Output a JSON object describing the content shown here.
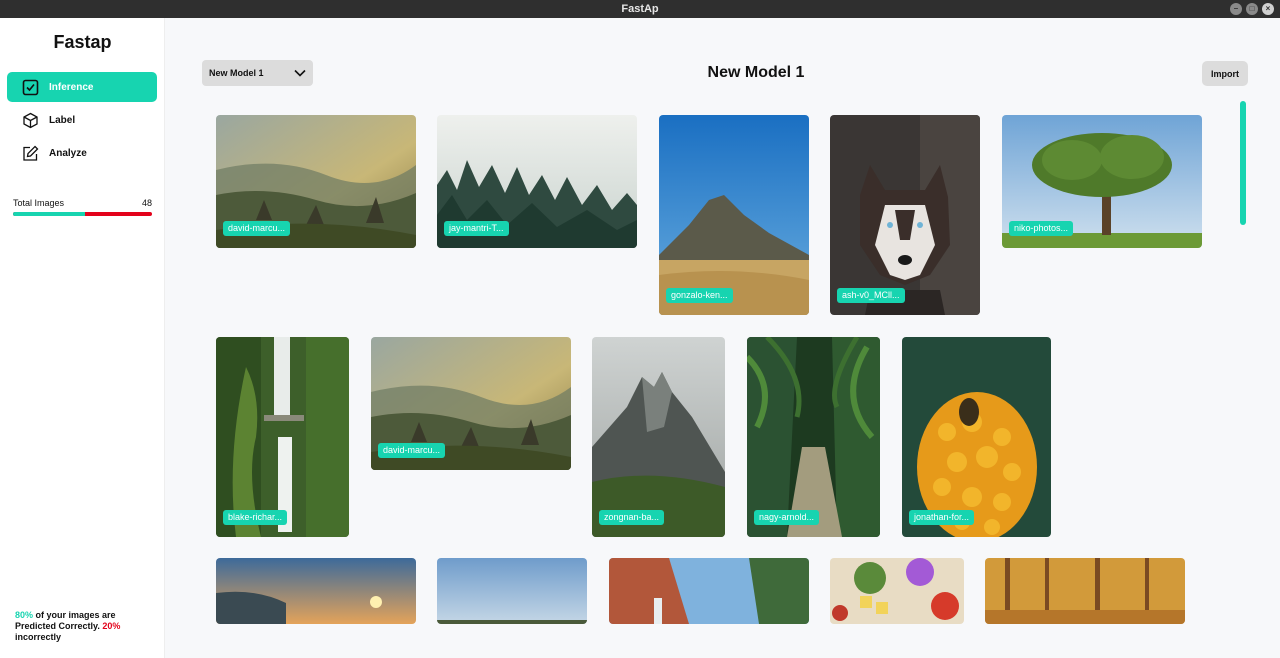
{
  "window": {
    "title": "FastAp"
  },
  "sidebar": {
    "brand": "Fastap",
    "nav": [
      {
        "label": "Inference",
        "icon": "check-square-icon",
        "active": true
      },
      {
        "label": "Label",
        "icon": "cube-icon",
        "active": false
      },
      {
        "label": "Analyze",
        "icon": "edit-icon",
        "active": false
      }
    ],
    "stats": {
      "label": "Total Images",
      "value": "48",
      "correct_fraction": 0.52
    },
    "summary": {
      "correct_pct": "80%",
      "text1": " of your images are Predicted Correctly. ",
      "incorrect_pct": "20%",
      "text2": " incorrectly"
    }
  },
  "header": {
    "model_select": "New Model 1",
    "title": "New Model 1",
    "import_label": "Import"
  },
  "colors": {
    "accent": "#17d4b0",
    "error": "#e3021b"
  },
  "images": [
    {
      "label": "david-marcu...",
      "scene": "valley"
    },
    {
      "label": "jay-mantri-T...",
      "scene": "fog"
    },
    {
      "label": "gonzalo-ken...",
      "scene": "mountain"
    },
    {
      "label": "ash-v0_MCll...",
      "scene": "husky"
    },
    {
      "label": "niko-photos...",
      "scene": "tree"
    },
    {
      "label": "blake-richar...",
      "scene": "waterfall"
    },
    {
      "label": "david-marcu...",
      "scene": "valley"
    },
    {
      "label": "zongnan-ba...",
      "scene": "peak"
    },
    {
      "label": "nagy-arnold...",
      "scene": "jungle"
    },
    {
      "label": "jonathan-for...",
      "scene": "flowers"
    },
    {
      "label": "",
      "scene": "sunset"
    },
    {
      "label": "",
      "scene": "sky"
    },
    {
      "label": "",
      "scene": "canyon"
    },
    {
      "label": "",
      "scene": "food"
    },
    {
      "label": "",
      "scene": "forest"
    }
  ]
}
